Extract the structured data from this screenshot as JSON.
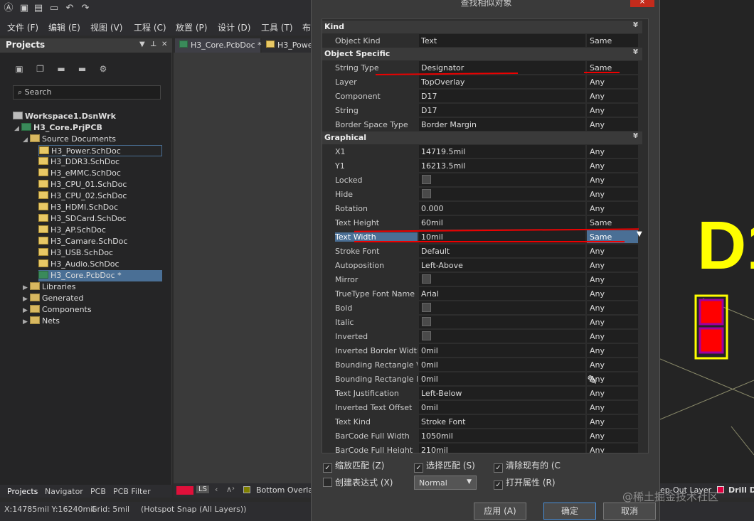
{
  "dialog": {
    "title": "查找相似对象",
    "close": "×",
    "sections": {
      "kind": "Kind",
      "object_specific": "Object Specific",
      "graphical": "Graphical"
    },
    "kind_rows": [
      {
        "name": "Object Kind",
        "value": "Text",
        "match": "Same"
      }
    ],
    "object_rows": [
      {
        "name": "String Type",
        "value": "Designator",
        "match": "Same"
      },
      {
        "name": "Layer",
        "value": "TopOverlay",
        "match": "Any"
      },
      {
        "name": "Component",
        "value": "D17",
        "match": "Any"
      },
      {
        "name": "String",
        "value": "D17",
        "match": "Any"
      },
      {
        "name": "Border Space Type",
        "value": "Border Margin",
        "match": "Any"
      }
    ],
    "graphical_rows": [
      {
        "name": "X1",
        "value": "14719.5mil",
        "match": "Any"
      },
      {
        "name": "Y1",
        "value": "16213.5mil",
        "match": "Any"
      },
      {
        "name": "Locked",
        "value": "",
        "match": "Any"
      },
      {
        "name": "Hide",
        "value": "",
        "match": "Any"
      },
      {
        "name": "Rotation",
        "value": "0.000",
        "match": "Any"
      },
      {
        "name": "Text Height",
        "value": "60mil",
        "match": "Same"
      },
      {
        "name": "Text Width",
        "value": "10mil",
        "match": "Same"
      },
      {
        "name": "Stroke Font",
        "value": "Default",
        "match": "Any"
      },
      {
        "name": "Autoposition",
        "value": "Left-Above",
        "match": "Any"
      },
      {
        "name": "Mirror",
        "value": "",
        "match": "Any"
      },
      {
        "name": "TrueType Font Name",
        "value": "Arial",
        "match": "Any"
      },
      {
        "name": "Bold",
        "value": "",
        "match": "Any"
      },
      {
        "name": "Italic",
        "value": "",
        "match": "Any"
      },
      {
        "name": "Inverted",
        "value": "",
        "match": "Any"
      },
      {
        "name": "Inverted Border Width",
        "value": "0mil",
        "match": "Any"
      },
      {
        "name": "Bounding Rectangle W",
        "value": "0mil",
        "match": "Any"
      },
      {
        "name": "Bounding Rectangle H",
        "value": "0mil",
        "match": "Any"
      },
      {
        "name": "Text Justification",
        "value": "Left-Below",
        "match": "Any"
      },
      {
        "name": "Inverted Text Offset",
        "value": "0mil",
        "match": "Any"
      },
      {
        "name": "Text Kind",
        "value": "Stroke Font",
        "match": "Any"
      },
      {
        "name": "BarCode Full Width",
        "value": "1050mil",
        "match": "Any"
      },
      {
        "name": "BarCode Full Height",
        "value": "210mil",
        "match": "Any"
      }
    ],
    "options": {
      "zoom_match": "缩放匹配 (Z)",
      "select_match": "选择匹配 (S)",
      "clear_existing": "清除现有的 (C",
      "create_expression": "创建表达式 (X)",
      "open_properties": "打开属性 (R)",
      "mode": "Normal"
    },
    "buttons": {
      "apply": "应用 (A)",
      "ok": "确定",
      "cancel": "取消"
    }
  },
  "menu": [
    "文件 (F)",
    "编辑 (E)",
    "视图 (V)",
    "工程 (C)",
    "放置 (P)",
    "设计 (D)",
    "工具 (T)",
    "布"
  ],
  "projects": {
    "title": "Projects",
    "search_placeholder": "Search",
    "workspace": "Workspace1.DsnWrk",
    "project": "H3_Core.PrjPCB",
    "source_folder": "Source Documents",
    "docs": [
      "H3_Power.SchDoc",
      "H3_DDR3.SchDoc",
      "H3_eMMC.SchDoc",
      "H3_CPU_01.SchDoc",
      "H3_CPU_02.SchDoc",
      "H3_HDMI.SchDoc",
      "H3_SDCard.SchDoc",
      "H3_AP.SchDoc",
      "H3_Camare.SchDoc",
      "H3_USB.SchDoc",
      "H3_Audio.SchDoc",
      "H3_Core.PcbDoc *"
    ],
    "folders": [
      "Libraries",
      "Generated",
      "Components",
      "Nets"
    ]
  },
  "doc_tabs": [
    "H3_Core.PcbDoc *",
    "H3_Powe"
  ],
  "bottom_tabs": [
    "Projects",
    "Navigator",
    "PCB",
    "PCB Filter"
  ],
  "layer_bar": {
    "ls": "LS",
    "bottom_overlay": "Bottom Overla"
  },
  "right_layers": {
    "keep_out": "ep-Out Layer",
    "drill": "Drill D"
  },
  "status": {
    "coords": "X:14785mil Y:16240mil",
    "grid": "Grid: 5mil",
    "snap": "(Hotspot Snap (All Layers))"
  },
  "pcb": {
    "designator": "D1"
  },
  "watermark": "@稀土掘金技术社区",
  "colors": {
    "accent": "#4a6f95",
    "highlight_red": "#e00000",
    "overlay_yellow": "#ffff00",
    "pad_red": "#ff0000"
  }
}
